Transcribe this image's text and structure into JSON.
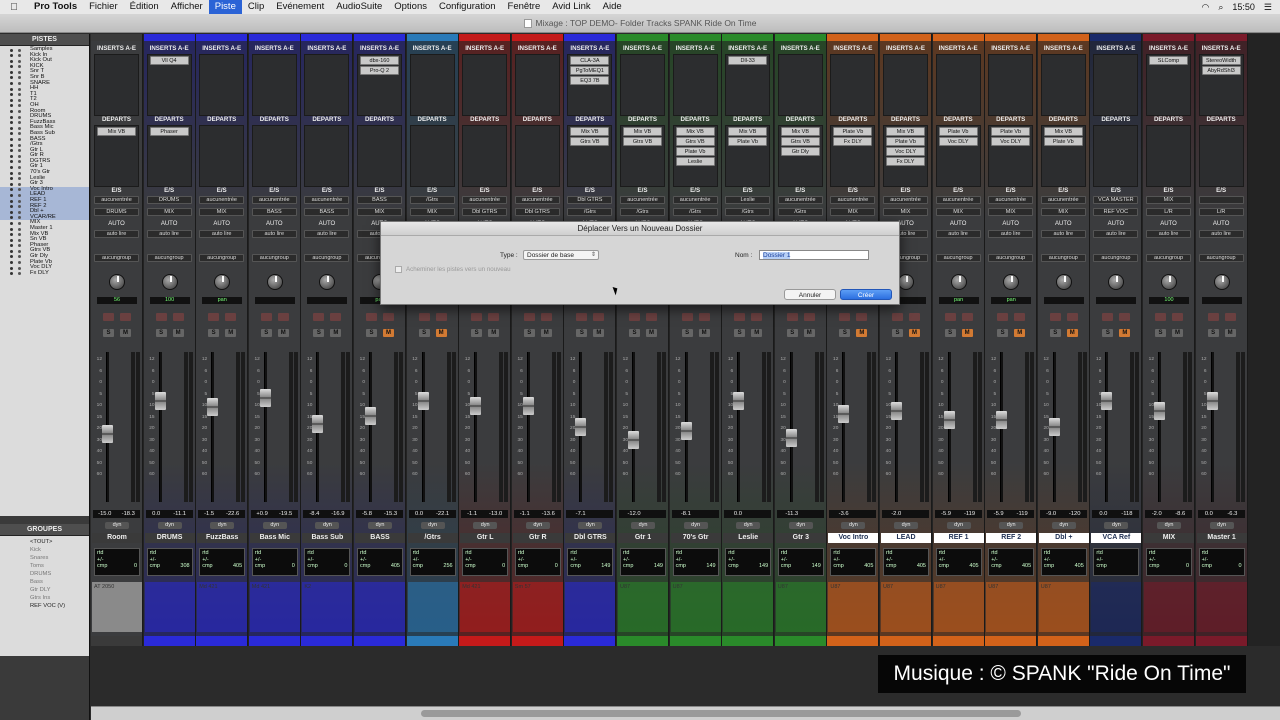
{
  "menubar": {
    "apple": "",
    "app": "Pro Tools",
    "items": [
      "Fichier",
      "Édition",
      "Afficher",
      "Piste",
      "Clip",
      "Evénement",
      "AudioSuite",
      "Options",
      "Configuration",
      "Fenêtre",
      "Avid Link",
      "Aide"
    ],
    "active_index": 3,
    "clock": "15:50"
  },
  "window": {
    "title": "Mixage : TOP DEMO- Folder Tracks SPANK Ride On Time"
  },
  "left": {
    "tracks_header": "PISTES",
    "groups_header": "GROUPES",
    "tracks": [
      "Samples",
      "Kick In",
      "Kick Out",
      "KICK",
      "Snr T",
      "Snr B",
      "SNARE",
      "HH",
      "T1",
      "T2",
      "OH",
      "Room",
      "DRUMS",
      "FuzzBass",
      "Bass Mic",
      "Bass Sub",
      "BASS",
      "/Gtrs",
      "Gtr L",
      "Gtr R",
      "DGTRS",
      "Gtr 1",
      "70's Gtr",
      "Leslie",
      "Gtr 3",
      "Voc Intro",
      "LEAD",
      "REF 1",
      "REF 2",
      "Dbl +",
      "VCAR/RE",
      "MIX",
      "Master 1",
      "Mix VB",
      "Sn VB",
      "Phaser",
      "Gtrs VB",
      "Gtr Dly",
      "Plate Vb",
      "Voc DLY",
      "Fx DLY"
    ],
    "groups": [
      "<TOUT>",
      "Kick",
      "Snares",
      "Toms",
      "DRUMS",
      "Bass",
      "Gtr DLY",
      "Gtrs Ins",
      "REF VOC (V)"
    ]
  },
  "labels": {
    "inserts": "INSERTS A-E",
    "sends": "DEPARTS",
    "io": "E/S",
    "auto": "AUTO",
    "autolire": "auto lire",
    "nogroup": "aucungroup",
    "dyn": "dyn",
    "rtd": "rtd",
    "cmp": "cmp",
    "pm": "+/-",
    "vcamaster": "VCA MASTER"
  },
  "strips": [
    {
      "name": "Room",
      "color": "#3a3a3a",
      "ins": [],
      "sends": [
        "Mix VB"
      ],
      "io_in": "aucunentrée",
      "io_out": "DRUMS",
      "pan": "56",
      "pan2": "56",
      "vol": "-15.0",
      "peak": "-18.3",
      "fader": 0.45,
      "comment": "AT 2050",
      "dly": "0"
    },
    {
      "name": "DRUMS",
      "color": "#2a2ad8",
      "ins": [
        "Vll Q4"
      ],
      "sends": [
        "Phaser"
      ],
      "io_in": "DRUMS",
      "io_out": "MIX",
      "pan": "100",
      "pan2": "100",
      "vol": "0.0",
      "peak": "-11.1",
      "fader": 0.7,
      "comment": "",
      "dly": "308"
    },
    {
      "name": "FuzzBass",
      "color": "#2a2ad8",
      "ins": [],
      "sends": [],
      "io_in": "aucunentrée",
      "io_out": "MIX",
      "pan": "pan",
      "pan2": "0",
      "vol": "-1.5",
      "peak": "-22.6",
      "fader": 0.65,
      "comment": "Md 421",
      "dly": "405"
    },
    {
      "name": "Bass Mic",
      "color": "#2a2ad8",
      "ins": [],
      "sends": [],
      "io_in": "aucunentrée",
      "io_out": "BASS",
      "pan": "",
      "pan2": "",
      "vol": "+0.9",
      "peak": "-19.5",
      "fader": 0.72,
      "comment": "Md 421",
      "dly": "0"
    },
    {
      "name": "Bass Sub",
      "color": "#2a2ad8",
      "ins": [],
      "sends": [],
      "io_in": "aucunentrée",
      "io_out": "BASS",
      "pan": "",
      "pan2": "",
      "vol": "-8.4",
      "peak": "-16.9",
      "fader": 0.52,
      "comment": "K2",
      "dly": "0"
    },
    {
      "name": "BASS",
      "color": "#2a2ad8",
      "ins": [
        "dbx-160",
        "Pro-Q 2"
      ],
      "sends": [],
      "io_in": "BASS",
      "io_out": "MIX",
      "pan": "pan",
      "pan2": "",
      "vol": "-5.8",
      "peak": "-15.3",
      "fader": 0.58,
      "comment": "",
      "dly": "405"
    },
    {
      "name": "/Gtrs",
      "color": "#2a7ab8",
      "ins": [],
      "sends": [],
      "io_in": "/Gtrs",
      "io_out": "MIX",
      "pan": "",
      "pan2": "",
      "vol": "0.0",
      "peak": "-22.1",
      "fader": 0.7,
      "comment": "",
      "dly": "256"
    },
    {
      "name": "Gtr L",
      "color": "#c41a1a",
      "ins": [],
      "sends": [],
      "io_in": "aucunentrée",
      "io_out": "Dbl GTRS",
      "pan": "",
      "pan2": "",
      "vol": "-1.1",
      "peak": "-13.0",
      "fader": 0.66,
      "comment": "Md 421",
      "dly": "0"
    },
    {
      "name": "Gtr R",
      "color": "#c41a1a",
      "ins": [],
      "sends": [],
      "io_in": "aucunentrée",
      "io_out": "Dbl GTRS",
      "pan": "",
      "pan2": "",
      "vol": "-1.1",
      "peak": "-13.6",
      "fader": 0.66,
      "comment": "Sm 57",
      "dly": "0"
    },
    {
      "name": "Dbl GTRS",
      "color": "#2a2ad8",
      "ins": [
        "CLA-3A",
        "PgToMEQ1",
        "EQ3 7B"
      ],
      "sends": [
        "Mix VB",
        "Gtrs VB"
      ],
      "io_in": "Dbl GTRS",
      "io_out": "/Gtrs",
      "pan": "",
      "pan2": "",
      "vol": "-7.1",
      "peak": "",
      "fader": 0.5,
      "comment": "",
      "dly": "149"
    },
    {
      "name": "Gtr 1",
      "color": "#2a8a2a",
      "ins": [],
      "sends": [
        "Mix VB",
        "Gtrs VB"
      ],
      "io_in": "aucunentrée",
      "io_out": "/Gtrs",
      "pan": "",
      "pan2": "",
      "vol": "-12.0",
      "peak": "",
      "fader": 0.4,
      "comment": "U87",
      "dly": "149"
    },
    {
      "name": "70's Gtr",
      "color": "#2a8a2a",
      "ins": [],
      "sends": [
        "Mix VB",
        "Gtrs VB",
        "Plate Vb",
        "Leslie"
      ],
      "io_in": "aucunentrée",
      "io_out": "/Gtrs",
      "pan": "",
      "pan2": "",
      "vol": "-8.1",
      "peak": "",
      "fader": 0.47,
      "comment": "U87",
      "dly": "149"
    },
    {
      "name": "Leslie",
      "color": "#2a8a2a",
      "ins": [
        "Dll-33"
      ],
      "sends": [
        "Mix VB",
        "Plate Vb"
      ],
      "io_in": "Leslie",
      "io_out": "/Gtrs",
      "pan": "",
      "pan2": "",
      "vol": "0.0",
      "peak": "",
      "fader": 0.7,
      "comment": "",
      "dly": "149"
    },
    {
      "name": "Gtr 3",
      "color": "#2a8a2a",
      "ins": [],
      "sends": [
        "Mix VB",
        "Gtrs VB",
        "Gtr Dly"
      ],
      "io_in": "aucunentrée",
      "io_out": "/Gtrs",
      "pan": "",
      "pan2": "",
      "vol": "-11.3",
      "peak": "",
      "fader": 0.42,
      "comment": "U87",
      "dly": "149"
    },
    {
      "name": "Voc Intro",
      "color": "#d2621a",
      "ins": [],
      "sends": [
        "Plate Vb",
        "Fx DLY"
      ],
      "io_in": "aucunentrée",
      "io_out": "MIX",
      "pan": "",
      "pan2": "",
      "vol": "-3.6",
      "peak": "",
      "fader": 0.6,
      "comment": "U87",
      "dly": "405"
    },
    {
      "name": "LEAD",
      "color": "#d2621a",
      "ins": [],
      "sends": [
        "Mix VB",
        "Plate Vb",
        "Voc DLY",
        "Fx DLY"
      ],
      "io_in": "aucunentrée",
      "io_out": "MIX",
      "pan": "",
      "pan2": "",
      "vol": "-2.0",
      "peak": "",
      "fader": 0.62,
      "comment": "U87",
      "dly": "405"
    },
    {
      "name": "REF 1",
      "color": "#d2621a",
      "ins": [],
      "sends": [
        "Plate Vb",
        "Voc DLY"
      ],
      "io_in": "aucunentrée",
      "io_out": "MIX",
      "pan": "pan",
      "pan2": "30",
      "vol": "-5.9",
      "peak": "-119",
      "fader": 0.55,
      "comment": "U87",
      "dly": "405"
    },
    {
      "name": "REF 2",
      "color": "#d2621a",
      "ins": [],
      "sends": [
        "Plate Vb",
        "Voc DLY"
      ],
      "io_in": "aucunentrée",
      "io_out": "MIX",
      "pan": "pan",
      "pan2": "30",
      "vol": "-5.9",
      "peak": "-119",
      "fader": 0.55,
      "comment": "U87",
      "dly": "405"
    },
    {
      "name": "Dbl +",
      "color": "#d2621a",
      "ins": [],
      "sends": [
        "Mix VB",
        "Plate Vb"
      ],
      "io_in": "aucunentrée",
      "io_out": "MIX",
      "pan": "",
      "pan2": "",
      "vol": "-9.0",
      "peak": "-120",
      "fader": 0.5,
      "comment": "U87",
      "dly": "405"
    },
    {
      "name": "VCA Ref",
      "color": "#1a2a6a",
      "ins": [],
      "sends": [],
      "io_in": "VCA MASTER",
      "io_out": "REF VOC",
      "pan": "",
      "pan2": "",
      "vol": "0.0",
      "peak": "-118",
      "fader": 0.7,
      "comment": "",
      "dly": ""
    },
    {
      "name": "MIX",
      "color": "#7a1a2a",
      "ins": [
        "SLComp"
      ],
      "sends": [],
      "io_in": "MIX",
      "io_out": "L/R",
      "pan": "100",
      "pan2": "100",
      "vol": "-2.0",
      "peak": "-8.6",
      "fader": 0.62,
      "comment": "",
      "dly": "0"
    },
    {
      "name": "Master 1",
      "color": "#7a1a2a",
      "ins": [
        "StereoWidth",
        "AbyRdShl3"
      ],
      "sends": [],
      "io_in": "",
      "io_out": "L/R",
      "pan": "",
      "pan2": "",
      "vol": "0.0",
      "peak": "-6.3",
      "fader": 0.7,
      "comment": "",
      "dly": "0"
    }
  ],
  "dialog": {
    "title": "Déplacer Vers un Nouveau Dossier",
    "type_label": "Type :",
    "type_value": "Dossier de base",
    "name_label": "Nom :",
    "name_value": "Dossier 1",
    "route_label": "Acheminer les pistes vers un nouveau",
    "cancel": "Annuler",
    "ok": "Créer"
  },
  "credit": "Musique : © SPANK \"Ride On Time\""
}
